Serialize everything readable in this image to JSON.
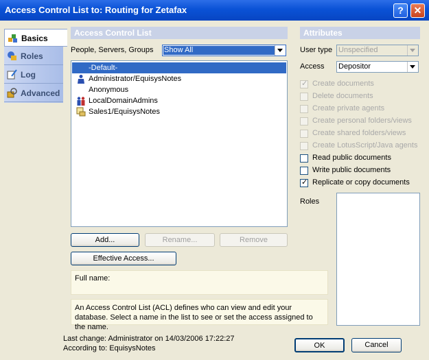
{
  "window": {
    "title": "Access Control List to: Routing for Zetafax",
    "help_label": "?",
    "close_label": "✕"
  },
  "sidebar": {
    "items": [
      {
        "label": "Basics",
        "icon": "basics-icon",
        "active": true
      },
      {
        "label": "Roles",
        "icon": "roles-icon"
      },
      {
        "label": "Log",
        "icon": "log-icon"
      },
      {
        "label": "Advanced",
        "icon": "advanced-icon"
      }
    ]
  },
  "acl": {
    "header": "Access Control List",
    "filter_label": "People, Servers, Groups",
    "filter_value": "Show All",
    "entries": [
      {
        "name": "-Default-",
        "icon": "",
        "selected": true
      },
      {
        "name": "Administrator/EquisysNotes",
        "icon": "person-icon"
      },
      {
        "name": "Anonymous",
        "icon": ""
      },
      {
        "name": "LocalDomainAdmins",
        "icon": "group-icon"
      },
      {
        "name": "Sales1/EquisysNotes",
        "icon": "server-icon"
      }
    ],
    "buttons": {
      "add": "Add...",
      "rename": "Rename...",
      "remove": "Remove",
      "effective": "Effective Access..."
    },
    "full_name_label": "Full name:",
    "description": "An Access Control List (ACL) defines who can view and edit your database. Select a name in the list to see or set the access assigned to the name."
  },
  "attributes": {
    "header": "Attributes",
    "user_type_label": "User type",
    "user_type_value": "Unspecified",
    "access_label": "Access",
    "access_value": "Depositor",
    "checkboxes": [
      {
        "label": "Create documents",
        "checked": true,
        "enabled": false
      },
      {
        "label": "Delete documents",
        "checked": false,
        "enabled": false
      },
      {
        "label": "Create private agents",
        "checked": false,
        "enabled": false
      },
      {
        "label": "Create personal folders/views",
        "checked": false,
        "enabled": false
      },
      {
        "label": "Create shared folders/views",
        "checked": false,
        "enabled": false
      },
      {
        "label": "Create LotusScript/Java agents",
        "checked": false,
        "enabled": false
      },
      {
        "label": "Read public documents",
        "checked": false,
        "enabled": true
      },
      {
        "label": "Write public documents",
        "checked": false,
        "enabled": true
      },
      {
        "label": "Replicate or copy documents",
        "checked": true,
        "enabled": true
      }
    ],
    "roles_label": "Roles"
  },
  "footer": {
    "last_change": "Last change: Administrator on 14/03/2006 17:22:27",
    "according_to": "According to: EquisysNotes",
    "ok": "OK",
    "cancel": "Cancel"
  },
  "colors": {
    "title_bar": "#0a52d6",
    "selection": "#316ac5",
    "panel_header": "#c9d2e7",
    "dialog_bg": "#ece9d8"
  }
}
